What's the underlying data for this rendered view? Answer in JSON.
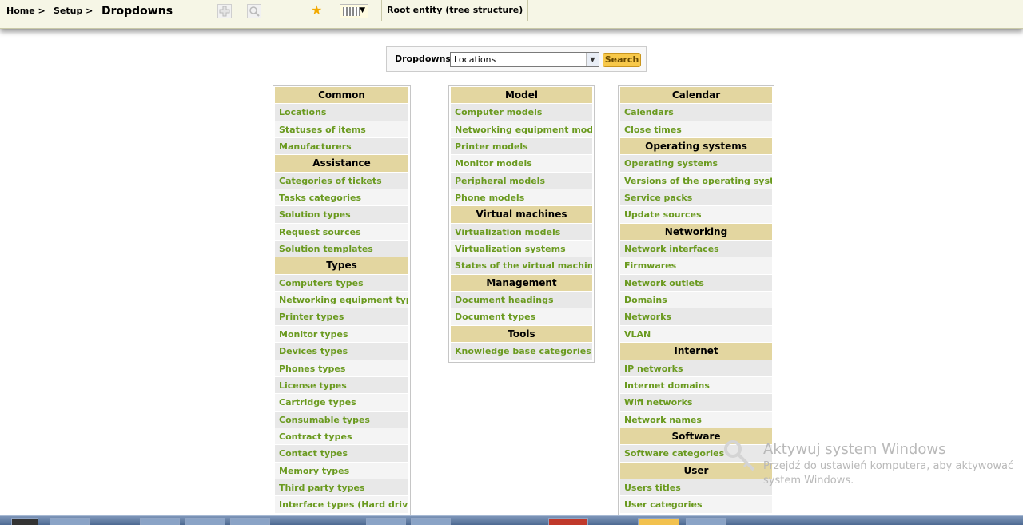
{
  "header": {
    "crumb_home": "Home >",
    "crumb_setup": "Setup >",
    "title": "Dropdowns",
    "root_entity": "Root entity (tree structure)"
  },
  "search": {
    "label": "Dropdowns",
    "selected": "Locations",
    "button": "Search"
  },
  "column1": [
    {
      "type": "header",
      "label": "Common"
    },
    {
      "type": "item",
      "label": "Locations"
    },
    {
      "type": "item",
      "label": "Statuses of items"
    },
    {
      "type": "item",
      "label": "Manufacturers"
    },
    {
      "type": "header",
      "label": "Assistance"
    },
    {
      "type": "item",
      "label": "Categories of tickets"
    },
    {
      "type": "item",
      "label": "Tasks categories"
    },
    {
      "type": "item",
      "label": "Solution types"
    },
    {
      "type": "item",
      "label": "Request sources"
    },
    {
      "type": "item",
      "label": "Solution templates"
    },
    {
      "type": "header",
      "label": "Types"
    },
    {
      "type": "item",
      "label": "Computers types"
    },
    {
      "type": "item",
      "label": "Networking equipment types"
    },
    {
      "type": "item",
      "label": "Printer types"
    },
    {
      "type": "item",
      "label": "Monitor types"
    },
    {
      "type": "item",
      "label": "Devices types"
    },
    {
      "type": "item",
      "label": "Phones types"
    },
    {
      "type": "item",
      "label": "License types"
    },
    {
      "type": "item",
      "label": "Cartridge types"
    },
    {
      "type": "item",
      "label": "Consumable types"
    },
    {
      "type": "item",
      "label": "Contract types"
    },
    {
      "type": "item",
      "label": "Contact types"
    },
    {
      "type": "item",
      "label": "Memory types"
    },
    {
      "type": "item",
      "label": "Third party types"
    },
    {
      "type": "item",
      "label": "Interface types (Hard drive...)"
    }
  ],
  "column2": [
    {
      "type": "header",
      "label": "Model"
    },
    {
      "type": "item",
      "label": "Computer models"
    },
    {
      "type": "item",
      "label": "Networking equipment models"
    },
    {
      "type": "item",
      "label": "Printer models"
    },
    {
      "type": "item",
      "label": "Monitor models"
    },
    {
      "type": "item",
      "label": "Peripheral models"
    },
    {
      "type": "item",
      "label": "Phone models"
    },
    {
      "type": "header",
      "label": "Virtual machines"
    },
    {
      "type": "item",
      "label": "Virtualization models"
    },
    {
      "type": "item",
      "label": "Virtualization systems"
    },
    {
      "type": "item",
      "label": "States of the virtual machine"
    },
    {
      "type": "header",
      "label": "Management"
    },
    {
      "type": "item",
      "label": "Document headings"
    },
    {
      "type": "item",
      "label": "Document types"
    },
    {
      "type": "header",
      "label": "Tools"
    },
    {
      "type": "item",
      "label": "Knowledge base categories"
    }
  ],
  "column3": [
    {
      "type": "header",
      "label": "Calendar"
    },
    {
      "type": "item",
      "label": "Calendars"
    },
    {
      "type": "item",
      "label": "Close times"
    },
    {
      "type": "header",
      "label": "Operating systems"
    },
    {
      "type": "item",
      "label": "Operating systems"
    },
    {
      "type": "item",
      "label": "Versions of the operating system"
    },
    {
      "type": "item",
      "label": "Service packs"
    },
    {
      "type": "item",
      "label": "Update sources"
    },
    {
      "type": "header",
      "label": "Networking"
    },
    {
      "type": "item",
      "label": "Network interfaces"
    },
    {
      "type": "item",
      "label": "Firmwares"
    },
    {
      "type": "item",
      "label": "Network outlets"
    },
    {
      "type": "item",
      "label": "Domains"
    },
    {
      "type": "item",
      "label": "Networks"
    },
    {
      "type": "item",
      "label": "VLAN"
    },
    {
      "type": "header",
      "label": "Internet"
    },
    {
      "type": "item",
      "label": "IP networks"
    },
    {
      "type": "item",
      "label": "Internet domains"
    },
    {
      "type": "item",
      "label": "Wifi networks"
    },
    {
      "type": "item",
      "label": "Network names"
    },
    {
      "type": "header",
      "label": "Software"
    },
    {
      "type": "item",
      "label": "Software categories"
    },
    {
      "type": "header",
      "label": "User"
    },
    {
      "type": "item",
      "label": "Users titles"
    },
    {
      "type": "item",
      "label": "User categories"
    }
  ],
  "watermark": {
    "title": "Aktywuj system Windows",
    "line1": "Przejdź do ustawień komputera, aby aktywować",
    "line2": "system Windows."
  },
  "icons": {
    "add": "add-icon",
    "search": "search-icon",
    "bookmark": "star-icon",
    "columns": "columns-icon",
    "key": "key-icon"
  },
  "colors": {
    "header_bg": "#e3d6a0",
    "link": "#6a9a1f",
    "button": "#f7c84a"
  }
}
